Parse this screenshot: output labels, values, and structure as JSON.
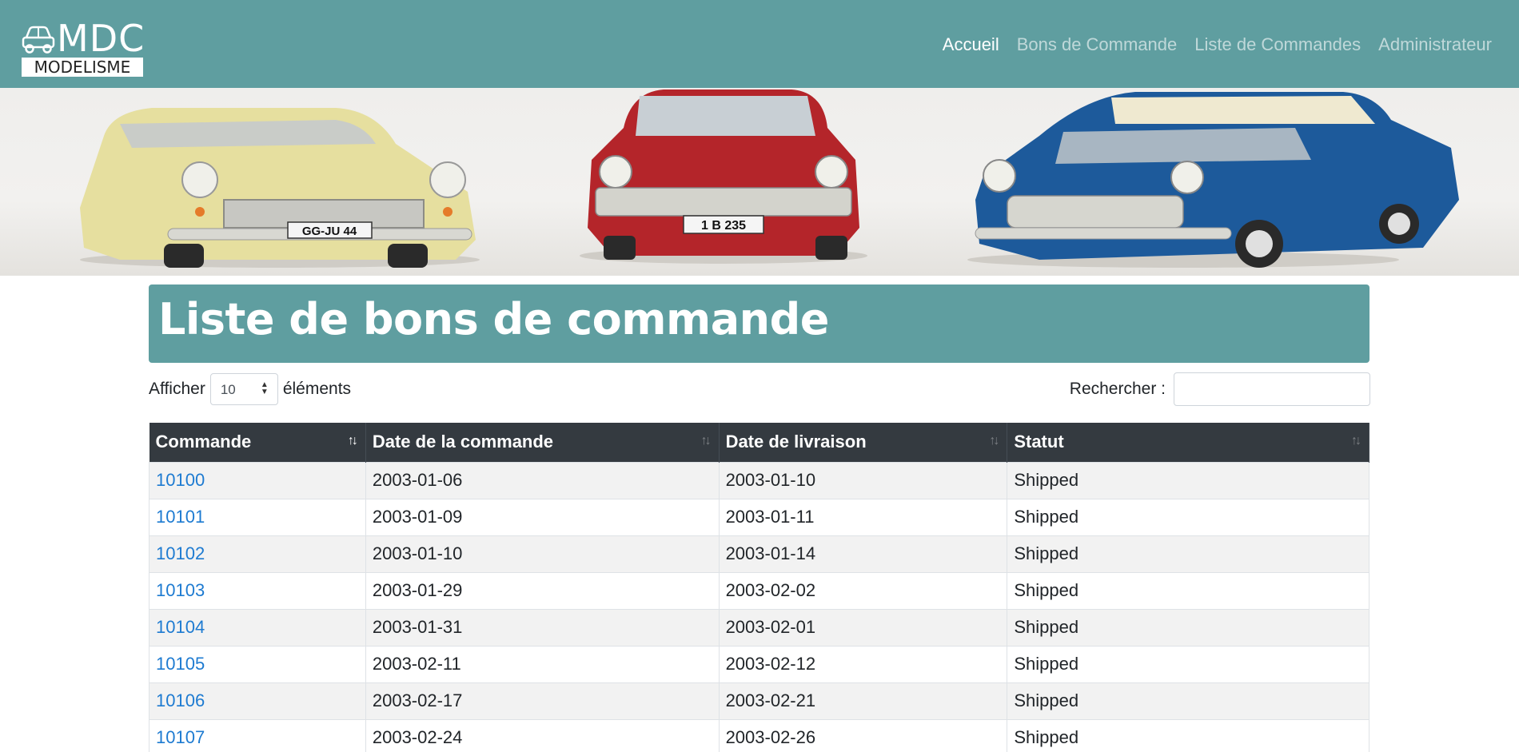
{
  "navbar": {
    "brand": "MDC",
    "brand_sub": "MODELISME",
    "links": [
      {
        "label": "Accueil",
        "active": true
      },
      {
        "label": "Bons de Commande",
        "active": false
      },
      {
        "label": "Liste de Commandes",
        "active": false
      },
      {
        "label": "Administrateur",
        "active": false
      }
    ]
  },
  "banner": {
    "plates": [
      "GG-JU 44",
      "1 B 235"
    ]
  },
  "page": {
    "title": "Liste de bons de commande"
  },
  "controls": {
    "show_prefix": "Afficher",
    "show_value": "10",
    "show_suffix": "éléments",
    "search_label": "Rechercher :",
    "search_value": ""
  },
  "table": {
    "columns": [
      "Commande",
      "Date de la commande",
      "Date de livraison",
      "Statut"
    ],
    "rows": [
      [
        "10100",
        "2003-01-06",
        "2003-01-10",
        "Shipped"
      ],
      [
        "10101",
        "2003-01-09",
        "2003-01-11",
        "Shipped"
      ],
      [
        "10102",
        "2003-01-10",
        "2003-01-14",
        "Shipped"
      ],
      [
        "10103",
        "2003-01-29",
        "2003-02-02",
        "Shipped"
      ],
      [
        "10104",
        "2003-01-31",
        "2003-02-01",
        "Shipped"
      ],
      [
        "10105",
        "2003-02-11",
        "2003-02-12",
        "Shipped"
      ],
      [
        "10106",
        "2003-02-17",
        "2003-02-21",
        "Shipped"
      ],
      [
        "10107",
        "2003-02-24",
        "2003-02-26",
        "Shipped"
      ]
    ]
  },
  "colors": {
    "teal": "#5f9ea0",
    "header_dark": "#343a40",
    "link": "#1e7bd1"
  }
}
